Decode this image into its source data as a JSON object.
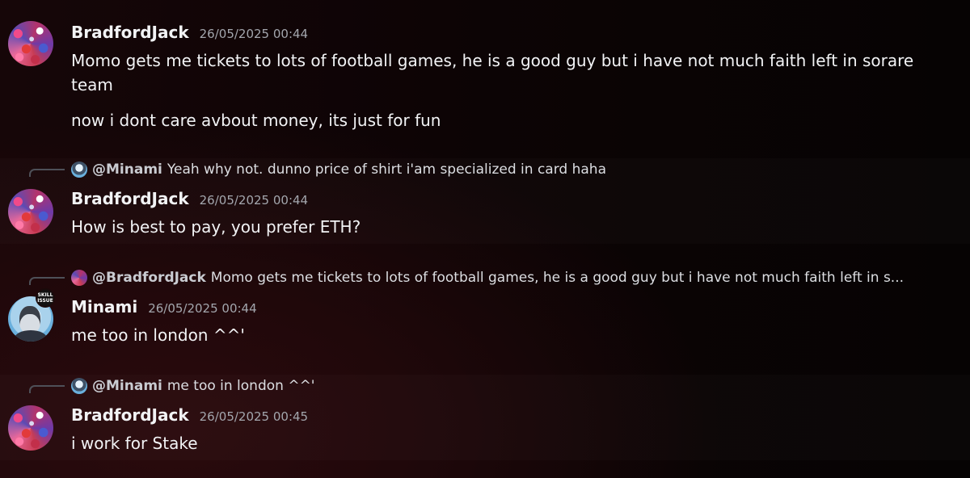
{
  "messages": [
    {
      "username": "BradfordJack",
      "timestamp": "26/05/2025 00:44",
      "lines": [
        "Momo gets me tickets to lots of football games, he is a good guy but i have not much faith left in sorare team",
        "now i dont care avbout money, its just for fun"
      ]
    },
    {
      "reply": {
        "mention": "@Minami",
        "text": "Yeah why not. dunno price of shirt i'am specialized in card haha"
      },
      "username": "BradfordJack",
      "timestamp": "26/05/2025 00:44",
      "lines": [
        "How is best to pay, you prefer ETH?"
      ]
    },
    {
      "reply": {
        "mention": "@BradfordJack",
        "text": "Momo gets me tickets to lots of football games, he is a good guy but i have not much faith left in s..."
      },
      "username": "Minami",
      "timestamp": "26/05/2025 00:44",
      "badge": "SKILL ISSUE",
      "lines": [
        "me too in london ^^'"
      ]
    },
    {
      "reply": {
        "mention": "@Minami",
        "text": "me too in london ^^'"
      },
      "username": "BradfordJack",
      "timestamp": "26/05/2025 00:45",
      "lines": [
        "i work for Stake"
      ]
    }
  ],
  "colors": {
    "background": "#0d0405",
    "username": "#f2f3f5",
    "timestamp": "#a3a6ad",
    "reply_spine": "#4e5058"
  }
}
